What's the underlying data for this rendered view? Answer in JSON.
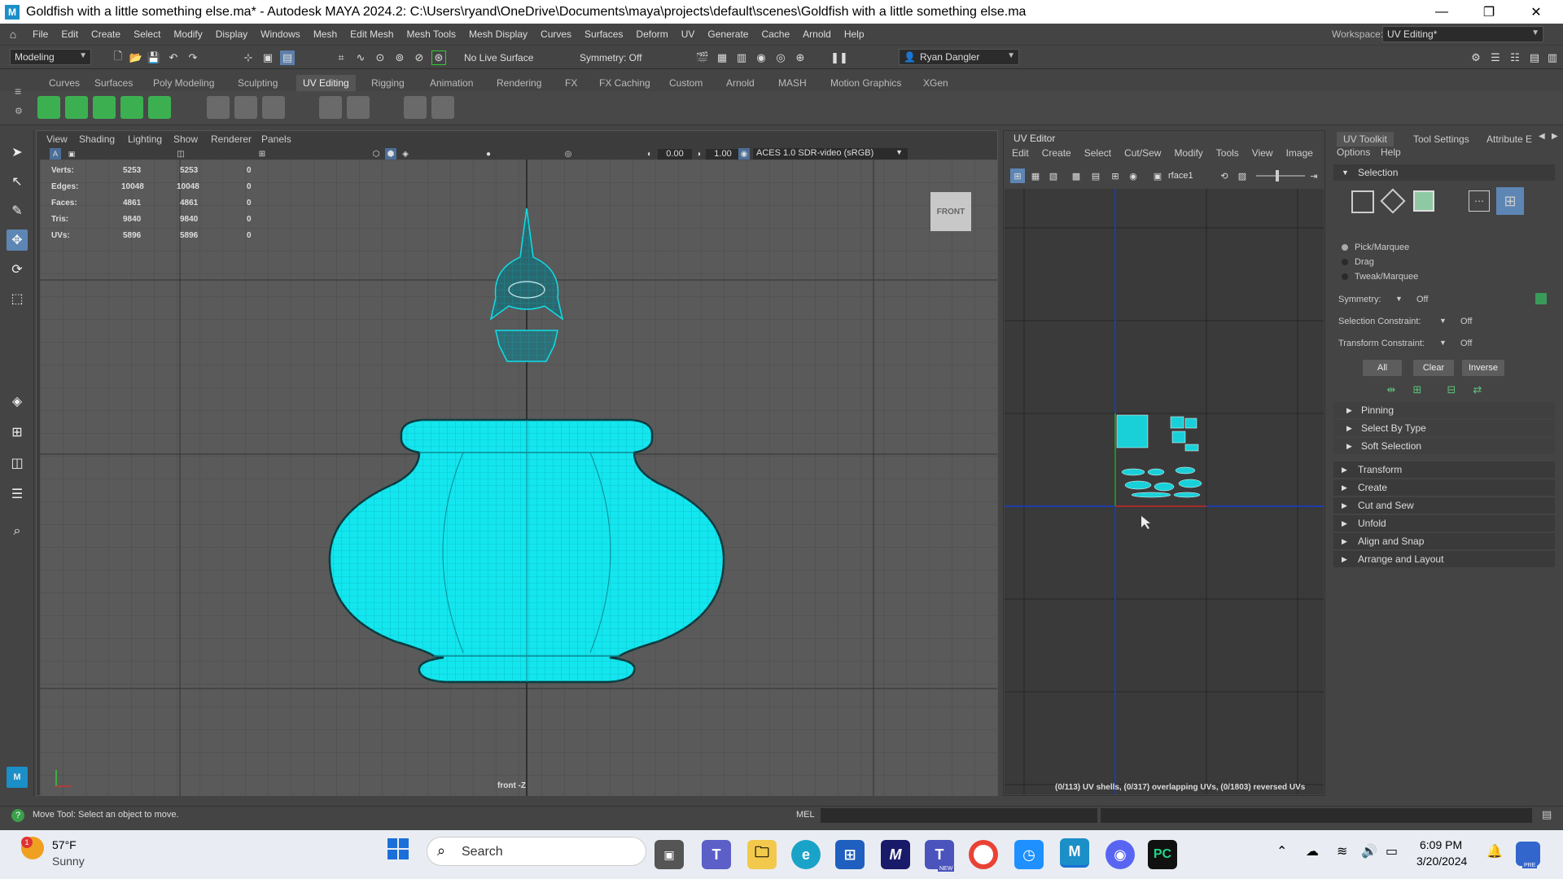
{
  "window": {
    "title": "Goldfish with a little something else.ma* - Autodesk MAYA 2024.2: C:\\Users\\ryand\\OneDrive\\Documents\\maya\\projects\\default\\scenes\\Goldfish with a little something else.ma",
    "icon_letter": "M",
    "minimize": "—",
    "restore": "❐",
    "close": "✕"
  },
  "menubar": {
    "items": [
      "File",
      "Edit",
      "Create",
      "Select",
      "Modify",
      "Display",
      "Windows",
      "Mesh",
      "Edit Mesh",
      "Mesh Tools",
      "Mesh Display",
      "Curves",
      "Surfaces",
      "Deform",
      "UV",
      "Generate",
      "Cache",
      "Arnold",
      "Help"
    ],
    "workspace_label": "Workspace:",
    "workspace_value": "UV Editing*"
  },
  "statusline": {
    "menuset": "Modeling",
    "live_surface": "No Live Surface",
    "symmetry": "Symmetry: Off",
    "user": "Ryan Dangler"
  },
  "shelf": {
    "tabs": [
      "Curves",
      "Surfaces",
      "Poly Modeling",
      "Sculpting",
      "UV Editing",
      "Rigging",
      "Animation",
      "Rendering",
      "FX",
      "FX Caching",
      "Custom",
      "Arnold",
      "MASH",
      "Motion Graphics",
      "XGen"
    ],
    "active_tab": "UV Editing"
  },
  "viewport": {
    "menu": [
      "View",
      "Shading",
      "Lighting",
      "Show",
      "Renderer",
      "Panels"
    ],
    "exposure": "0.00",
    "gamma": "1.00",
    "color_space": "ACES 1.0 SDR-video (sRGB)",
    "camera_label": "front -Z",
    "view_cube": "FRONT",
    "stats": [
      {
        "label": "Verts:",
        "a": "5253",
        "b": "5253",
        "c": "0"
      },
      {
        "label": "Edges:",
        "a": "10048",
        "b": "10048",
        "c": "0"
      },
      {
        "label": "Faces:",
        "a": "4861",
        "b": "4861",
        "c": "0"
      },
      {
        "label": "Tris:",
        "a": "9840",
        "b": "9840",
        "c": "0"
      },
      {
        "label": "UVs:",
        "a": "5896",
        "b": "5896",
        "c": "0"
      }
    ],
    "mesh_color": "#13e6ee"
  },
  "uv_editor": {
    "title": "UV Editor",
    "menu": [
      "Edit",
      "Create",
      "Select",
      "Cut/Sew",
      "Modify",
      "Tools",
      "View",
      "Image"
    ],
    "uv_set": "rface1",
    "status": "(0/113) UV shells, (0/317) overlapping UVs, (0/1803) reversed UVs"
  },
  "uv_toolkit": {
    "tabs": [
      "UV Toolkit",
      "Tool Settings",
      "Attribute E"
    ],
    "menu": [
      "Options",
      "Help"
    ],
    "selection_header": "Selection",
    "modes": [
      "Pick/Marquee",
      "Drag",
      "Tweak/Marquee"
    ],
    "symmetry_label": "Symmetry:",
    "symmetry_value": "Off",
    "sel_constraint_label": "Selection Constraint:",
    "sel_constraint_value": "Off",
    "xform_constraint_label": "Transform Constraint:",
    "xform_constraint_value": "Off",
    "buttons": [
      "All",
      "Clear",
      "Inverse"
    ],
    "subsections": [
      "Pinning",
      "Select By Type",
      "Soft Selection"
    ],
    "sections": [
      "Transform",
      "Create",
      "Cut and Sew",
      "Unfold",
      "Align and Snap",
      "Arrange and Layout"
    ]
  },
  "helpline": {
    "message": "Move Tool: Select an object to move.",
    "cmd_lang": "MEL"
  },
  "taskbar": {
    "temp": "57°F",
    "weather": "Sunny",
    "weather_badge": "1",
    "search_placeholder": "Search",
    "time": "6:09 PM",
    "date": "3/20/2024",
    "new_badge": "NEW",
    "pre_badge": "PRE"
  }
}
